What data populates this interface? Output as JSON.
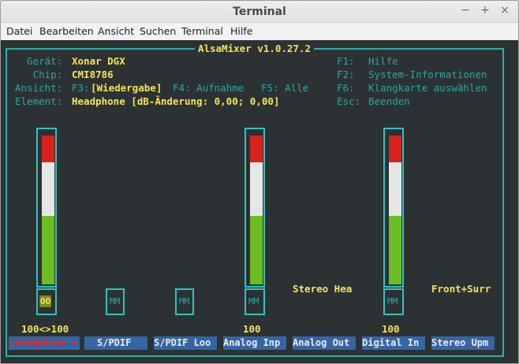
{
  "window": {
    "title": "Terminal",
    "controls": {
      "minimize": "−",
      "maximize": "+",
      "close": "×"
    }
  },
  "menubar": {
    "items": [
      "Datei",
      "Bearbeiten",
      "Ansicht",
      "Suchen",
      "Terminal",
      "Hilfe"
    ]
  },
  "alsamixer": {
    "title": "AlsaMixer v1.0.27.2",
    "info": {
      "device_label": "  Gerät:",
      "device_value": "Xonar DGX",
      "chip_label": "   Chip:",
      "chip_value": "CMI8786",
      "view_label": "Ansicht:",
      "view_f3": "F3:",
      "view_f3_value": "[Wiedergabe]",
      "view_f4": "F4: Aufnahme",
      "view_f5": "F5: Alle",
      "element_label": "Element:",
      "element_value": "Headphone [dB-Änderung: 0,00; 0,00]"
    },
    "help": [
      {
        "key": "F1:",
        "label": "Hilfe"
      },
      {
        "key": "F2:",
        "label": "System-Informationen"
      },
      {
        "key": "F6:",
        "label": "Klangkarte auswählen"
      },
      {
        "key": "Esc:",
        "label": "Beenden"
      }
    ],
    "channels": [
      {
        "name": "<Headphone >",
        "level_label": "100<>100",
        "mute": "OO",
        "level": 1.0
      },
      {
        "name": "S/PDIF",
        "mute": "MM"
      },
      {
        "name": "S/PDIF Loo",
        "mute": "MM"
      },
      {
        "name": "Analog Inp",
        "level_label": "100",
        "mute": "MM",
        "level": 1.0
      },
      {
        "name": "Analog Out",
        "enum_value": "Stereo Hea"
      },
      {
        "name": "Digital In",
        "level_label": "100",
        "mute": "MM",
        "level": 1.0
      },
      {
        "name": "Stereo Upm",
        "enum_value": "Front+Surr"
      }
    ]
  },
  "colors": {
    "terminal_bg": "#2c3133",
    "cyan": "#28a9a4",
    "yellow": "#f7e35a",
    "meter_red": "#d7211b",
    "meter_white": "#e6e6e6",
    "meter_green": "#6bbd21",
    "tab_blue": "#3465a4",
    "active_tab_text": "#e8262b"
  }
}
